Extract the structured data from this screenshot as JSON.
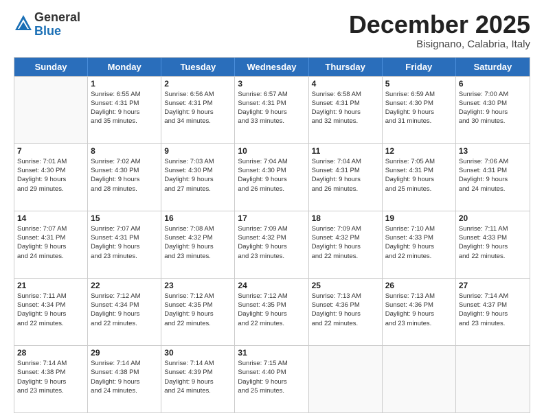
{
  "header": {
    "logo": {
      "general": "General",
      "blue": "Blue"
    },
    "title": "December 2025",
    "subtitle": "Bisignano, Calabria, Italy"
  },
  "days_of_week": [
    "Sunday",
    "Monday",
    "Tuesday",
    "Wednesday",
    "Thursday",
    "Friday",
    "Saturday"
  ],
  "weeks": [
    [
      {
        "day": null,
        "info": null
      },
      {
        "day": "1",
        "info": "Sunrise: 6:55 AM\nSunset: 4:31 PM\nDaylight: 9 hours\nand 35 minutes."
      },
      {
        "day": "2",
        "info": "Sunrise: 6:56 AM\nSunset: 4:31 PM\nDaylight: 9 hours\nand 34 minutes."
      },
      {
        "day": "3",
        "info": "Sunrise: 6:57 AM\nSunset: 4:31 PM\nDaylight: 9 hours\nand 33 minutes."
      },
      {
        "day": "4",
        "info": "Sunrise: 6:58 AM\nSunset: 4:31 PM\nDaylight: 9 hours\nand 32 minutes."
      },
      {
        "day": "5",
        "info": "Sunrise: 6:59 AM\nSunset: 4:30 PM\nDaylight: 9 hours\nand 31 minutes."
      },
      {
        "day": "6",
        "info": "Sunrise: 7:00 AM\nSunset: 4:30 PM\nDaylight: 9 hours\nand 30 minutes."
      }
    ],
    [
      {
        "day": "7",
        "info": "Sunrise: 7:01 AM\nSunset: 4:30 PM\nDaylight: 9 hours\nand 29 minutes."
      },
      {
        "day": "8",
        "info": "Sunrise: 7:02 AM\nSunset: 4:30 PM\nDaylight: 9 hours\nand 28 minutes."
      },
      {
        "day": "9",
        "info": "Sunrise: 7:03 AM\nSunset: 4:30 PM\nDaylight: 9 hours\nand 27 minutes."
      },
      {
        "day": "10",
        "info": "Sunrise: 7:04 AM\nSunset: 4:30 PM\nDaylight: 9 hours\nand 26 minutes."
      },
      {
        "day": "11",
        "info": "Sunrise: 7:04 AM\nSunset: 4:31 PM\nDaylight: 9 hours\nand 26 minutes."
      },
      {
        "day": "12",
        "info": "Sunrise: 7:05 AM\nSunset: 4:31 PM\nDaylight: 9 hours\nand 25 minutes."
      },
      {
        "day": "13",
        "info": "Sunrise: 7:06 AM\nSunset: 4:31 PM\nDaylight: 9 hours\nand 24 minutes."
      }
    ],
    [
      {
        "day": "14",
        "info": "Sunrise: 7:07 AM\nSunset: 4:31 PM\nDaylight: 9 hours\nand 24 minutes."
      },
      {
        "day": "15",
        "info": "Sunrise: 7:07 AM\nSunset: 4:31 PM\nDaylight: 9 hours\nand 23 minutes."
      },
      {
        "day": "16",
        "info": "Sunrise: 7:08 AM\nSunset: 4:32 PM\nDaylight: 9 hours\nand 23 minutes."
      },
      {
        "day": "17",
        "info": "Sunrise: 7:09 AM\nSunset: 4:32 PM\nDaylight: 9 hours\nand 23 minutes."
      },
      {
        "day": "18",
        "info": "Sunrise: 7:09 AM\nSunset: 4:32 PM\nDaylight: 9 hours\nand 22 minutes."
      },
      {
        "day": "19",
        "info": "Sunrise: 7:10 AM\nSunset: 4:33 PM\nDaylight: 9 hours\nand 22 minutes."
      },
      {
        "day": "20",
        "info": "Sunrise: 7:11 AM\nSunset: 4:33 PM\nDaylight: 9 hours\nand 22 minutes."
      }
    ],
    [
      {
        "day": "21",
        "info": "Sunrise: 7:11 AM\nSunset: 4:34 PM\nDaylight: 9 hours\nand 22 minutes."
      },
      {
        "day": "22",
        "info": "Sunrise: 7:12 AM\nSunset: 4:34 PM\nDaylight: 9 hours\nand 22 minutes."
      },
      {
        "day": "23",
        "info": "Sunrise: 7:12 AM\nSunset: 4:35 PM\nDaylight: 9 hours\nand 22 minutes."
      },
      {
        "day": "24",
        "info": "Sunrise: 7:12 AM\nSunset: 4:35 PM\nDaylight: 9 hours\nand 22 minutes."
      },
      {
        "day": "25",
        "info": "Sunrise: 7:13 AM\nSunset: 4:36 PM\nDaylight: 9 hours\nand 22 minutes."
      },
      {
        "day": "26",
        "info": "Sunrise: 7:13 AM\nSunset: 4:36 PM\nDaylight: 9 hours\nand 23 minutes."
      },
      {
        "day": "27",
        "info": "Sunrise: 7:14 AM\nSunset: 4:37 PM\nDaylight: 9 hours\nand 23 minutes."
      }
    ],
    [
      {
        "day": "28",
        "info": "Sunrise: 7:14 AM\nSunset: 4:38 PM\nDaylight: 9 hours\nand 23 minutes."
      },
      {
        "day": "29",
        "info": "Sunrise: 7:14 AM\nSunset: 4:38 PM\nDaylight: 9 hours\nand 24 minutes."
      },
      {
        "day": "30",
        "info": "Sunrise: 7:14 AM\nSunset: 4:39 PM\nDaylight: 9 hours\nand 24 minutes."
      },
      {
        "day": "31",
        "info": "Sunrise: 7:15 AM\nSunset: 4:40 PM\nDaylight: 9 hours\nand 25 minutes."
      },
      {
        "day": null,
        "info": null
      },
      {
        "day": null,
        "info": null
      },
      {
        "day": null,
        "info": null
      }
    ]
  ]
}
